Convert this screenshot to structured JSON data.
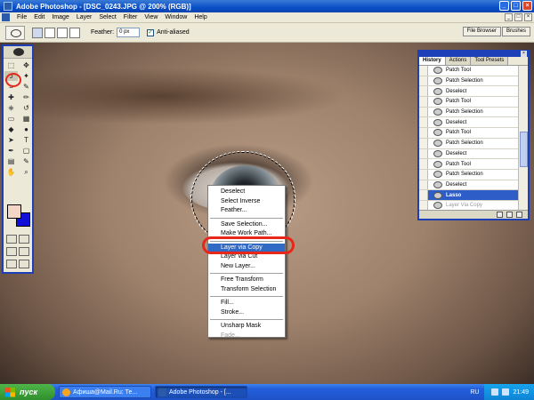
{
  "window": {
    "title": "Adobe Photoshop - [DSC_0243.JPG @ 200% (RGB)]",
    "controls": [
      "_",
      "□",
      "×"
    ]
  },
  "menubar": {
    "items": [
      "File",
      "Edit",
      "Image",
      "Layer",
      "Select",
      "Filter",
      "View",
      "Window",
      "Help"
    ],
    "doc_controls": [
      "_",
      "□",
      "×"
    ]
  },
  "options": {
    "feather_label": "Feather:",
    "feather_value": "0 px",
    "antialias_label": "Anti-aliased",
    "antialias_checked": true,
    "well_tabs": [
      "File Browser",
      "Brushes"
    ]
  },
  "history": {
    "tabs": [
      "History",
      "Actions",
      "Tool Presets"
    ],
    "items": [
      {
        "label": "Patch Tool",
        "state": "normal"
      },
      {
        "label": "Patch Selection",
        "state": "normal"
      },
      {
        "label": "Deselect",
        "state": "normal"
      },
      {
        "label": "Patch Tool",
        "state": "normal"
      },
      {
        "label": "Patch Selection",
        "state": "normal"
      },
      {
        "label": "Deselect",
        "state": "normal"
      },
      {
        "label": "Patch Tool",
        "state": "normal"
      },
      {
        "label": "Patch Selection",
        "state": "normal"
      },
      {
        "label": "Deselect",
        "state": "normal"
      },
      {
        "label": "Patch Tool",
        "state": "normal"
      },
      {
        "label": "Patch Selection",
        "state": "normal"
      },
      {
        "label": "Deselect",
        "state": "normal"
      },
      {
        "label": "Lasso",
        "state": "selected"
      },
      {
        "label": "Layer Via Copy",
        "state": "dimmed"
      }
    ]
  },
  "context_menu": {
    "groups": [
      [
        {
          "label": "Deselect",
          "state": "normal"
        },
        {
          "label": "Select Inverse",
          "state": "normal"
        },
        {
          "label": "Feather...",
          "state": "normal"
        }
      ],
      [
        {
          "label": "Save Selection...",
          "state": "normal"
        },
        {
          "label": "Make Work Path...",
          "state": "normal"
        }
      ],
      [
        {
          "label": "Layer via Copy",
          "state": "highlighted"
        },
        {
          "label": "Layer via Cut",
          "state": "normal"
        },
        {
          "label": "New Layer...",
          "state": "normal"
        }
      ],
      [
        {
          "label": "Free Transform",
          "state": "normal"
        },
        {
          "label": "Transform Selection",
          "state": "normal"
        }
      ],
      [
        {
          "label": "Fill...",
          "state": "normal"
        },
        {
          "label": "Stroke...",
          "state": "normal"
        }
      ],
      [
        {
          "label": "Unsharp Mask",
          "state": "normal"
        },
        {
          "label": "Fade...",
          "state": "disabled"
        }
      ]
    ]
  },
  "toolbox": {
    "tools": [
      "marquee",
      "move",
      "lasso",
      "magic-wand",
      "crop",
      "slice",
      "healing",
      "brush",
      "stamp",
      "history-brush",
      "eraser",
      "gradient",
      "blur",
      "dodge",
      "path-select",
      "type",
      "pen",
      "shape",
      "notes",
      "eyedropper",
      "hand",
      "zoom"
    ],
    "tool_glyphs": [
      "⬚",
      "✥",
      "ↄ",
      "✦",
      "⌗",
      "✎",
      "✚",
      "✏",
      "⎈",
      "↺",
      "▭",
      "▦",
      "◆",
      "●",
      "➤",
      "T",
      "✒",
      "▢",
      "▤",
      "✎",
      "✋",
      "⌕"
    ],
    "selected_tool_index": 2,
    "foreground_color": "#f3d6c6",
    "background_color": "#1010d8"
  },
  "taskbar": {
    "start_label": "пуск",
    "tasks": [
      {
        "label": "Афиша@Mail.Ru: Те...",
        "active": false,
        "icon": "browser-icon"
      },
      {
        "label": "Adobe Photoshop - [...",
        "active": true,
        "icon": "photoshop-icon"
      }
    ],
    "language": "RU",
    "clock": "21:49"
  },
  "colors": {
    "annotation_red": "#e8261a",
    "selection_blue": "#2f5dc8",
    "menu_highlight": "#316ac5"
  }
}
